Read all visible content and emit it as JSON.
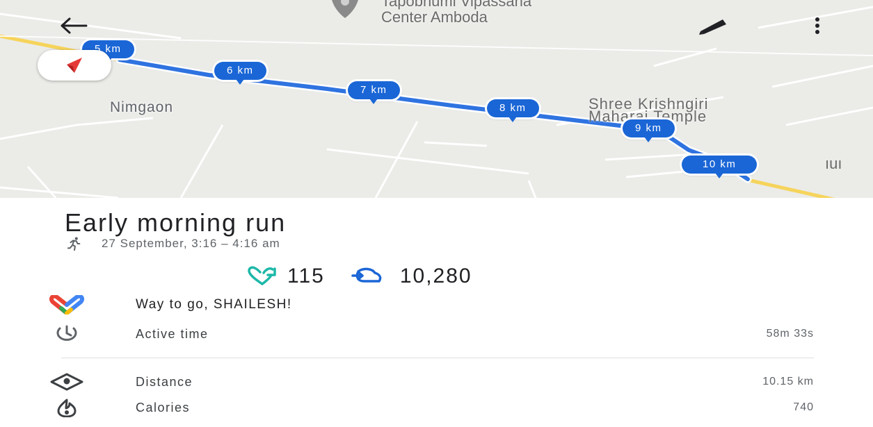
{
  "map": {
    "poi_top": "Tapobhumi Vipassana",
    "poi_bottom": "Center Amboda",
    "places": {
      "nimgaon": "Nimgaon",
      "temple_line1": "Shree Krishngiri",
      "temple_line2": "Maharai Temple",
      "cut_label": "ıuı"
    },
    "km_markers": [
      "5 km",
      "6 km",
      "7 km",
      "8 km",
      "9 km",
      "10 km"
    ],
    "route_color": "#1a66d6",
    "icons": {
      "back": "arrow-left-icon",
      "edit": "pencil-icon",
      "more": "more-vertical-icon",
      "compass": "compass-icon",
      "poi": "place-pin-icon"
    }
  },
  "activity": {
    "title": "Early morning run",
    "datetime": "27 September, 3:16 – 4:16 am",
    "heart_points": "115",
    "steps": "10,280",
    "congrats": "Way to go, SHAILESH!",
    "metrics": [
      {
        "label": "Active time",
        "value": "58m 33s",
        "icon": "timer-icon"
      },
      {
        "label": "Distance",
        "value": "10.15 km",
        "icon": "distance-icon"
      },
      {
        "label": "Calories",
        "value": "740",
        "icon": "calories-icon"
      }
    ],
    "colors": {
      "accent_teal": "#1db8a8",
      "accent_blue": "#1a66d6"
    }
  }
}
